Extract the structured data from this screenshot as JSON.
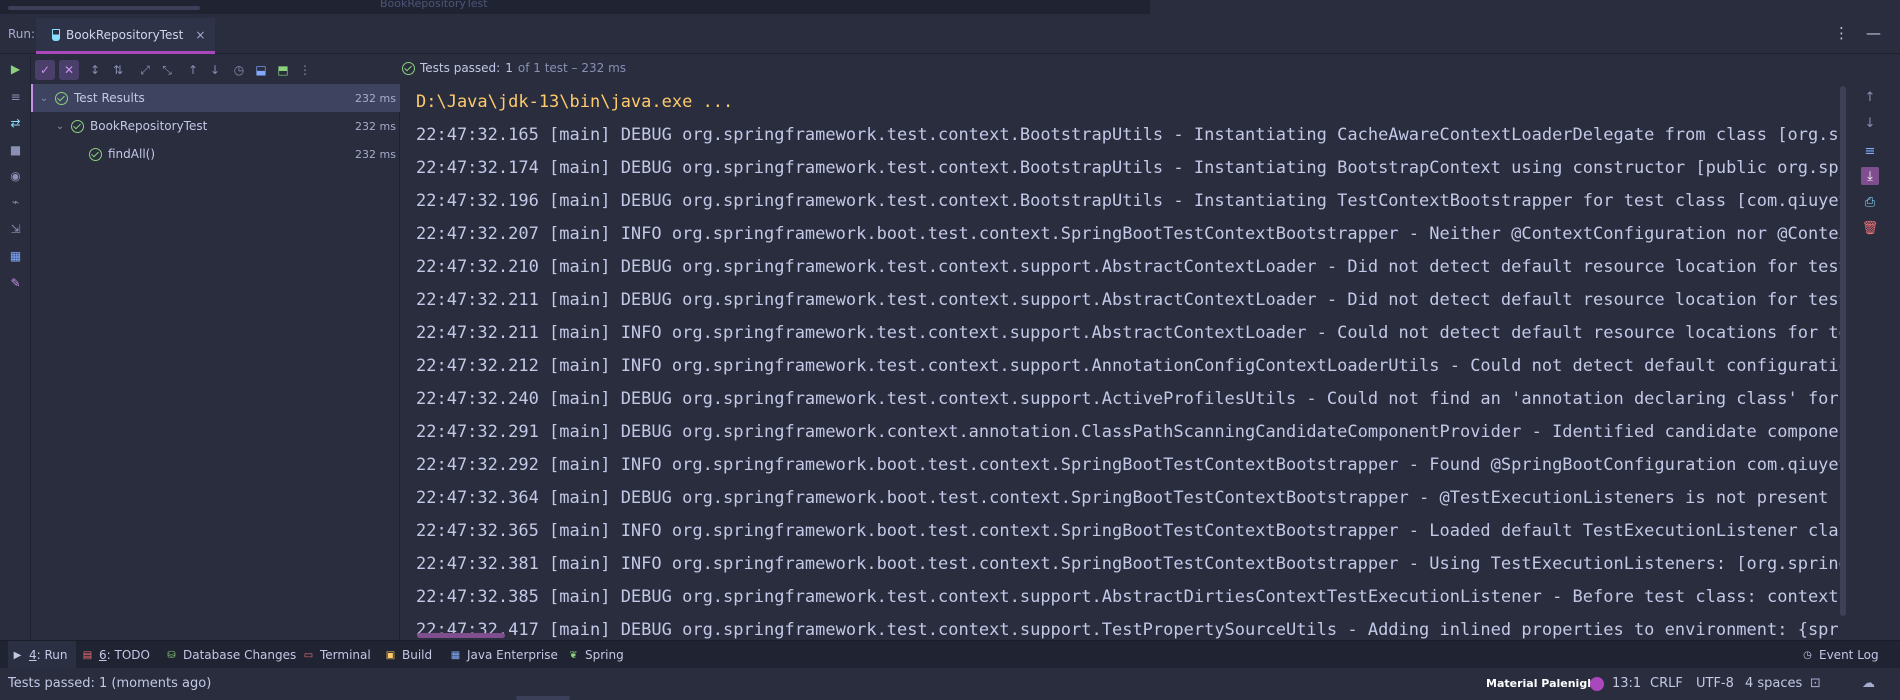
{
  "top": {
    "ghost_title": "BookRepositoryTest"
  },
  "header": {
    "run_label": "Run:",
    "tab_label": "BookRepositoryTest",
    "tab_close": "×",
    "more_icon": "⋮",
    "minimize_icon": "—"
  },
  "status_summary": {
    "prefix": "Tests passed:",
    "count": "1",
    "detail": "of 1 test – 232 ms"
  },
  "tree": {
    "rows": [
      {
        "label": "Test Results",
        "time": "232 ms"
      },
      {
        "label": "BookRepositoryTest",
        "time": "232 ms"
      },
      {
        "label": "findAll()",
        "time": "232 ms"
      }
    ]
  },
  "console": {
    "command": "D:\\Java\\jdk-13\\bin\\java.exe ...",
    "lines": [
      "22:47:32.165 [main] DEBUG org.springframework.test.context.BootstrapUtils - Instantiating CacheAwareContextLoaderDelegate from class [org.sprin",
      "22:47:32.174 [main] DEBUG org.springframework.test.context.BootstrapUtils - Instantiating BootstrapContext using constructor [public org.spring",
      "22:47:32.196 [main] DEBUG org.springframework.test.context.BootstrapUtils - Instantiating TestContextBootstrapper for test class [com.qiuyeyiji",
      "22:47:32.207 [main] INFO org.springframework.boot.test.context.SpringBootTestContextBootstrapper - Neither @ContextConfiguration nor @ContextHi",
      "22:47:32.210 [main] DEBUG org.springframework.test.context.support.AbstractContextLoader - Did not detect default resource location for test cl",
      "22:47:32.211 [main] DEBUG org.springframework.test.context.support.AbstractContextLoader - Did not detect default resource location for test cl",
      "22:47:32.211 [main] INFO org.springframework.test.context.support.AbstractContextLoader - Could not detect default resource locations for test",
      "22:47:32.212 [main] INFO org.springframework.test.context.support.AnnotationConfigContextLoaderUtils - Could not detect default configuration c",
      "22:47:32.240 [main] DEBUG org.springframework.test.context.support.ActiveProfilesUtils - Could not find an 'annotation declaring class' for ann",
      "22:47:32.291 [main] DEBUG org.springframework.context.annotation.ClassPathScanningCandidateComponentProvider - Identified candidate component c",
      "22:47:32.292 [main] INFO org.springframework.boot.test.context.SpringBootTestContextBootstrapper - Found @SpringBootConfiguration com.qiuyeyiji",
      "22:47:32.364 [main] DEBUG org.springframework.boot.test.context.SpringBootTestContextBootstrapper - @TestExecutionListeners is not present for",
      "22:47:32.365 [main] INFO org.springframework.boot.test.context.SpringBootTestContextBootstrapper - Loaded default TestExecutionListener class n",
      "22:47:32.381 [main] INFO org.springframework.boot.test.context.SpringBootTestContextBootstrapper - Using TestExecutionListeners: [org.springfra",
      "22:47:32.385 [main] DEBUG org.springframework.test.context.support.AbstractDirtiesContextTestExecutionListener - Before test class: context [De",
      "22:47:32.417 [main] DEBUG org.springframework.test.context.support.TestPropertySourceUtils - Adding inlined properties to environment: {spring"
    ]
  },
  "tool_windows": [
    {
      "prefix": "4",
      "label": ": Run",
      "icon": "run-icon"
    },
    {
      "prefix": "6",
      "label": ": TODO",
      "icon": "todo-icon"
    },
    {
      "prefix": "",
      "label": "Database Changes",
      "icon": "database-icon"
    },
    {
      "prefix": "",
      "label": "Terminal",
      "icon": "terminal-icon"
    },
    {
      "prefix": "",
      "label": "Build",
      "icon": "build-icon"
    },
    {
      "prefix": "",
      "label": "Java Enterprise",
      "icon": "java-enterprise-icon"
    },
    {
      "prefix": "",
      "label": "Spring",
      "icon": "spring-icon"
    }
  ],
  "event_log": "Event Log",
  "status_bar": {
    "message": "Tests passed: 1 (moments ago)",
    "theme": "Material Palenight",
    "position": "13:1",
    "line_ending": "CRLF",
    "encoding": "UTF-8",
    "indent": "4 spaces"
  },
  "colors": {
    "background": "#292d3e",
    "accent": "#ab47bc",
    "pass_green": "#8bd17c",
    "command_yellow": "#ffcb6b"
  }
}
